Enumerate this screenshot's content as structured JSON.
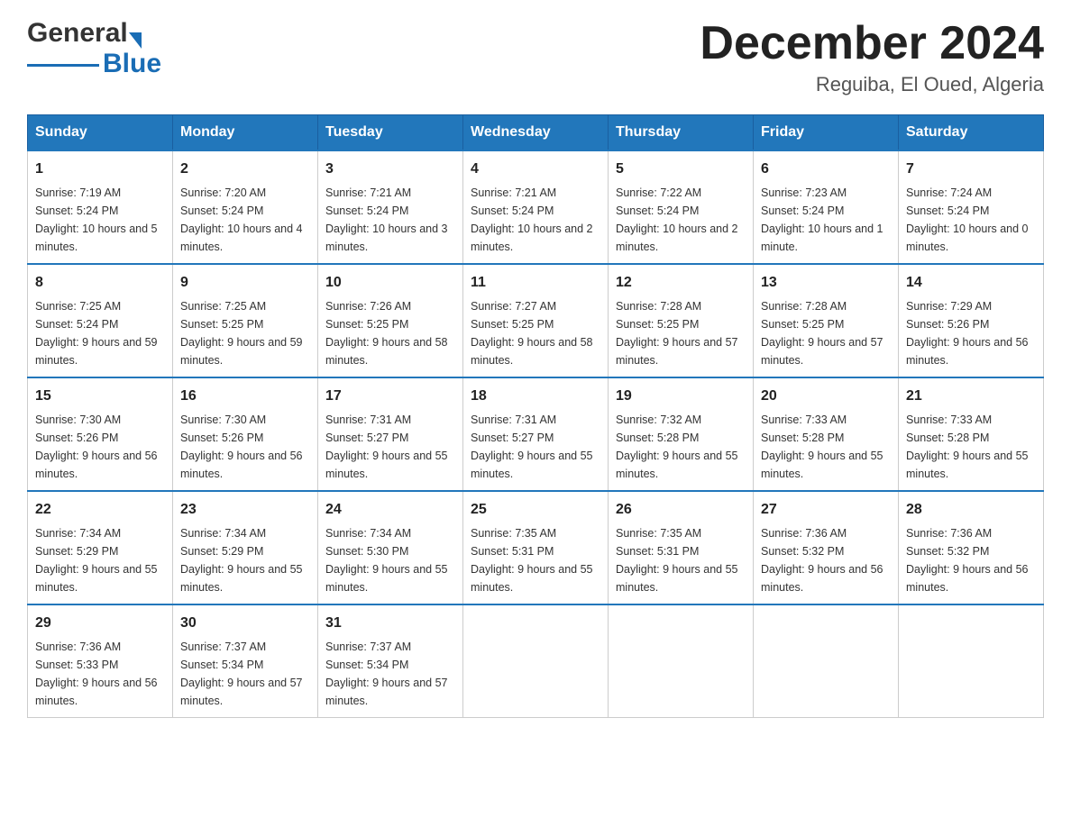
{
  "header": {
    "logo_general": "General",
    "logo_blue": "Blue",
    "month_title": "December 2024",
    "location": "Reguiba, El Oued, Algeria"
  },
  "days_of_week": [
    "Sunday",
    "Monday",
    "Tuesday",
    "Wednesday",
    "Thursday",
    "Friday",
    "Saturday"
  ],
  "weeks": [
    [
      {
        "day": "1",
        "sunrise": "7:19 AM",
        "sunset": "5:24 PM",
        "daylight": "10 hours and 5 minutes."
      },
      {
        "day": "2",
        "sunrise": "7:20 AM",
        "sunset": "5:24 PM",
        "daylight": "10 hours and 4 minutes."
      },
      {
        "day": "3",
        "sunrise": "7:21 AM",
        "sunset": "5:24 PM",
        "daylight": "10 hours and 3 minutes."
      },
      {
        "day": "4",
        "sunrise": "7:21 AM",
        "sunset": "5:24 PM",
        "daylight": "10 hours and 2 minutes."
      },
      {
        "day": "5",
        "sunrise": "7:22 AM",
        "sunset": "5:24 PM",
        "daylight": "10 hours and 2 minutes."
      },
      {
        "day": "6",
        "sunrise": "7:23 AM",
        "sunset": "5:24 PM",
        "daylight": "10 hours and 1 minute."
      },
      {
        "day": "7",
        "sunrise": "7:24 AM",
        "sunset": "5:24 PM",
        "daylight": "10 hours and 0 minutes."
      }
    ],
    [
      {
        "day": "8",
        "sunrise": "7:25 AM",
        "sunset": "5:24 PM",
        "daylight": "9 hours and 59 minutes."
      },
      {
        "day": "9",
        "sunrise": "7:25 AM",
        "sunset": "5:25 PM",
        "daylight": "9 hours and 59 minutes."
      },
      {
        "day": "10",
        "sunrise": "7:26 AM",
        "sunset": "5:25 PM",
        "daylight": "9 hours and 58 minutes."
      },
      {
        "day": "11",
        "sunrise": "7:27 AM",
        "sunset": "5:25 PM",
        "daylight": "9 hours and 58 minutes."
      },
      {
        "day": "12",
        "sunrise": "7:28 AM",
        "sunset": "5:25 PM",
        "daylight": "9 hours and 57 minutes."
      },
      {
        "day": "13",
        "sunrise": "7:28 AM",
        "sunset": "5:25 PM",
        "daylight": "9 hours and 57 minutes."
      },
      {
        "day": "14",
        "sunrise": "7:29 AM",
        "sunset": "5:26 PM",
        "daylight": "9 hours and 56 minutes."
      }
    ],
    [
      {
        "day": "15",
        "sunrise": "7:30 AM",
        "sunset": "5:26 PM",
        "daylight": "9 hours and 56 minutes."
      },
      {
        "day": "16",
        "sunrise": "7:30 AM",
        "sunset": "5:26 PM",
        "daylight": "9 hours and 56 minutes."
      },
      {
        "day": "17",
        "sunrise": "7:31 AM",
        "sunset": "5:27 PM",
        "daylight": "9 hours and 55 minutes."
      },
      {
        "day": "18",
        "sunrise": "7:31 AM",
        "sunset": "5:27 PM",
        "daylight": "9 hours and 55 minutes."
      },
      {
        "day": "19",
        "sunrise": "7:32 AM",
        "sunset": "5:28 PM",
        "daylight": "9 hours and 55 minutes."
      },
      {
        "day": "20",
        "sunrise": "7:33 AM",
        "sunset": "5:28 PM",
        "daylight": "9 hours and 55 minutes."
      },
      {
        "day": "21",
        "sunrise": "7:33 AM",
        "sunset": "5:28 PM",
        "daylight": "9 hours and 55 minutes."
      }
    ],
    [
      {
        "day": "22",
        "sunrise": "7:34 AM",
        "sunset": "5:29 PM",
        "daylight": "9 hours and 55 minutes."
      },
      {
        "day": "23",
        "sunrise": "7:34 AM",
        "sunset": "5:29 PM",
        "daylight": "9 hours and 55 minutes."
      },
      {
        "day": "24",
        "sunrise": "7:34 AM",
        "sunset": "5:30 PM",
        "daylight": "9 hours and 55 minutes."
      },
      {
        "day": "25",
        "sunrise": "7:35 AM",
        "sunset": "5:31 PM",
        "daylight": "9 hours and 55 minutes."
      },
      {
        "day": "26",
        "sunrise": "7:35 AM",
        "sunset": "5:31 PM",
        "daylight": "9 hours and 55 minutes."
      },
      {
        "day": "27",
        "sunrise": "7:36 AM",
        "sunset": "5:32 PM",
        "daylight": "9 hours and 56 minutes."
      },
      {
        "day": "28",
        "sunrise": "7:36 AM",
        "sunset": "5:32 PM",
        "daylight": "9 hours and 56 minutes."
      }
    ],
    [
      {
        "day": "29",
        "sunrise": "7:36 AM",
        "sunset": "5:33 PM",
        "daylight": "9 hours and 56 minutes."
      },
      {
        "day": "30",
        "sunrise": "7:37 AM",
        "sunset": "5:34 PM",
        "daylight": "9 hours and 57 minutes."
      },
      {
        "day": "31",
        "sunrise": "7:37 AM",
        "sunset": "5:34 PM",
        "daylight": "9 hours and 57 minutes."
      },
      null,
      null,
      null,
      null
    ]
  ],
  "labels": {
    "sunrise_prefix": "Sunrise: ",
    "sunset_prefix": "Sunset: ",
    "daylight_prefix": "Daylight: "
  }
}
